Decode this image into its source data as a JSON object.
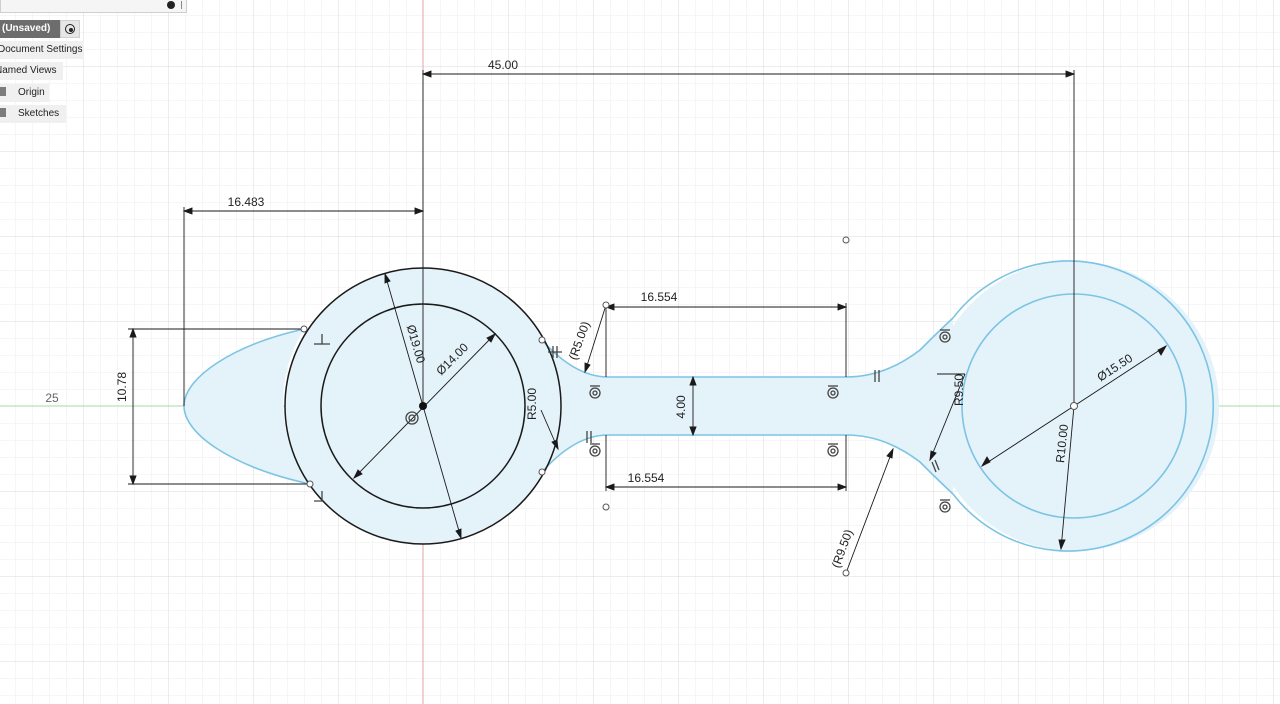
{
  "browser": {
    "root_label": "(Unsaved)",
    "items": [
      {
        "label": "Document Settings"
      },
      {
        "label": "Named Views"
      },
      {
        "label": "Origin"
      },
      {
        "label": "Sketches"
      }
    ]
  },
  "axis_label": "25",
  "dimensions": {
    "overall_length": "45.00",
    "tail_length": "16.483",
    "tail_width": "10.78",
    "large_outer_dia": "Ø19.00",
    "large_inner_dia": "Ø14.00",
    "fillet_r5": "R5.00",
    "fillet_r5_ref": "(R5.00)",
    "handle_len_top": "16.554",
    "handle_len_bottom": "16.554",
    "handle_width": "4.00",
    "fillet_r950": "R9.50",
    "fillet_r950_ref": "(R9.50)",
    "small_inner_dia": "Ø15.50",
    "small_outer_r": "R10.00"
  },
  "colors": {
    "profile_fill": "#e4f2fa",
    "profile_stroke": "#7cc4e4",
    "sketch_line": "#1a1a1a",
    "grid_minor": "#e9e9e9",
    "grid_major": "#d6d6d6",
    "axis_x": "#9fd49f",
    "axis_y": "#e4a0a0"
  }
}
